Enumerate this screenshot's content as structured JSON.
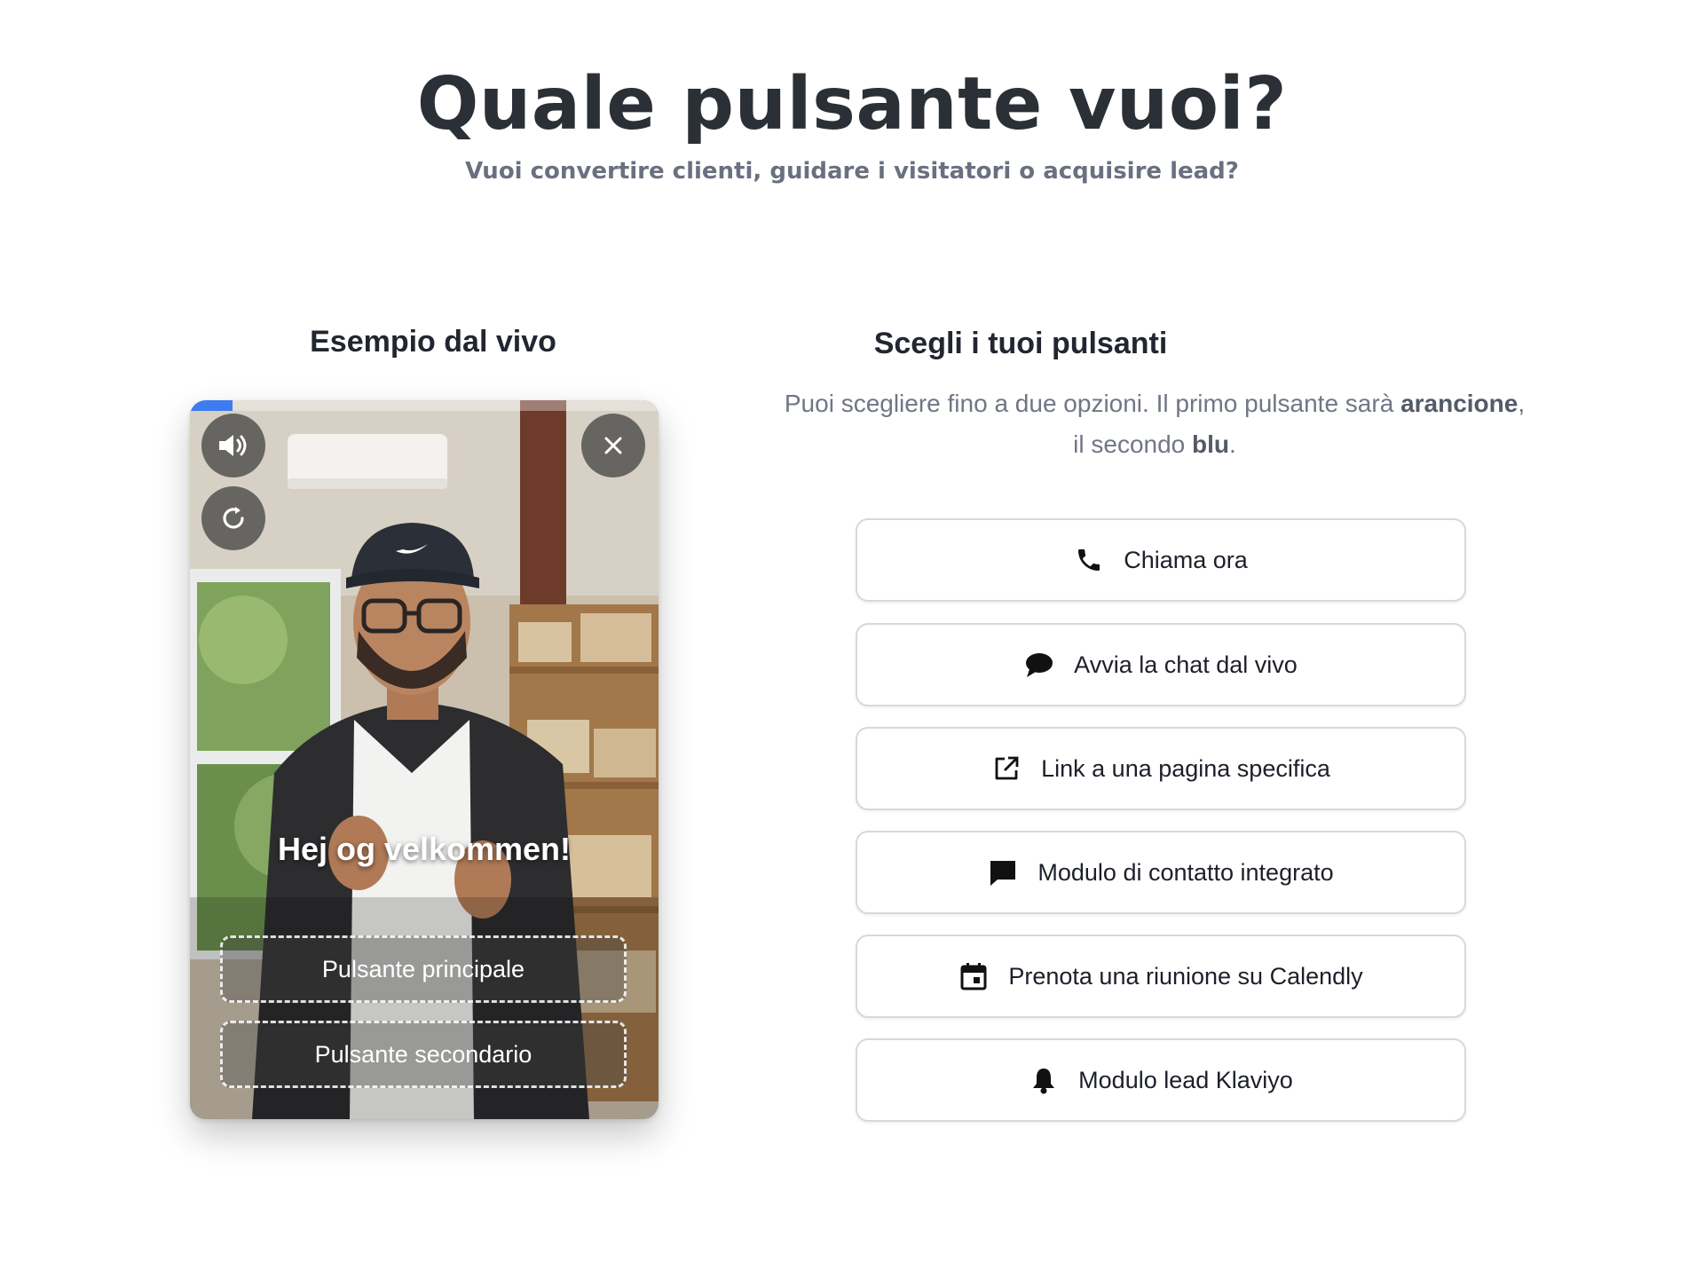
{
  "header": {
    "title": "Quale pulsante vuoi?",
    "subtitle": "Vuoi convertire clienti, guidare i visitatori o acquisire lead?"
  },
  "preview": {
    "heading": "Esempio dal vivo",
    "progress_fraction": 0.09,
    "caption": "Hej og velkommen!",
    "primary_label": "Pulsante principale",
    "secondary_label": "Pulsante secondario",
    "icons": {
      "sound": "speaker-icon",
      "replay": "replay-icon",
      "close": "close-icon"
    }
  },
  "options_panel": {
    "heading": "Scegli i tuoi pulsanti",
    "intro_part1": "Puoi scegliere fino a due opzioni. Il primo pulsante sarà ",
    "intro_orange": "arancione",
    "intro_part2": ",",
    "intro_part3": "il secondo ",
    "intro_blue": "blu",
    "intro_part4": ".",
    "options": [
      {
        "label": "Chiama ora",
        "icon": "phone-icon"
      },
      {
        "label": "Avvia la chat dal vivo",
        "icon": "chat-bubble-icon"
      },
      {
        "label": "Link a una pagina specifica",
        "icon": "external-link-icon"
      },
      {
        "label": "Modulo di contatto integrato",
        "icon": "message-icon"
      },
      {
        "label": "Prenota una riunione su Calendly",
        "icon": "calendar-icon"
      },
      {
        "label": "Modulo lead Klaviyo",
        "icon": "bell-icon"
      }
    ]
  },
  "colors": {
    "progress": "#3d7bf0",
    "heading_text": "#2b2f36",
    "muted_text": "#707684",
    "button_border": "#d5d8de"
  }
}
